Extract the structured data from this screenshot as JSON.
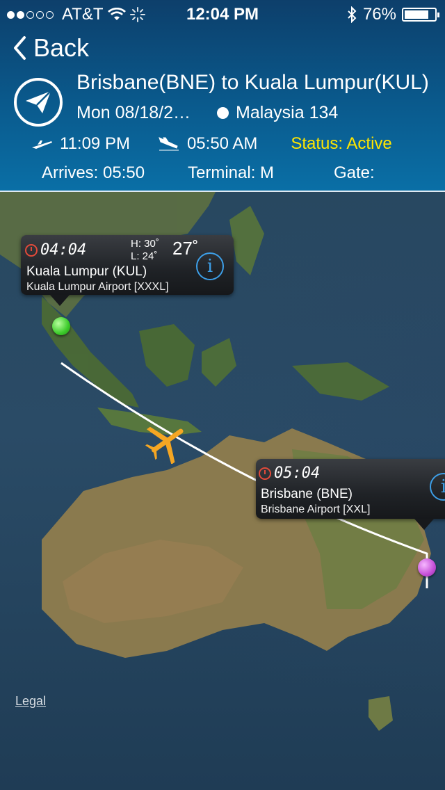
{
  "statusbar": {
    "carrier": "AT&T",
    "time": "12:04 PM",
    "battery": "76%"
  },
  "nav": {
    "back_label": "Back"
  },
  "flight": {
    "route": "Brisbane(BNE) to Kuala Lumpur(KUL)",
    "date": "Mon 08/18/2…",
    "flight_name": "Malaysia 134",
    "departure_time": "11:09 PM",
    "arrival_time": "05:50 AM",
    "status": "Status: Active",
    "arrives": "Arrives: 05:50",
    "terminal": "Terminal: M",
    "gate": "Gate:"
  },
  "map": {
    "legal": "Legal",
    "destination_callout": {
      "local_time": "04:04",
      "high": "H: 30˚",
      "low": "L: 24˚",
      "temp": "27˚",
      "city": "Kuala Lumpur (KUL)",
      "airport": "Kuala Lumpur Airport [XXXL]"
    },
    "origin_callout": {
      "local_time": "05:04",
      "city": "Brisbane (BNE)",
      "airport": "Brisbane Airport [XXL]"
    }
  },
  "colors": {
    "status_active": "#ffe600",
    "info_button": "#3d9fe8",
    "header": "#0a5a8d",
    "plane": "#f5a623"
  }
}
